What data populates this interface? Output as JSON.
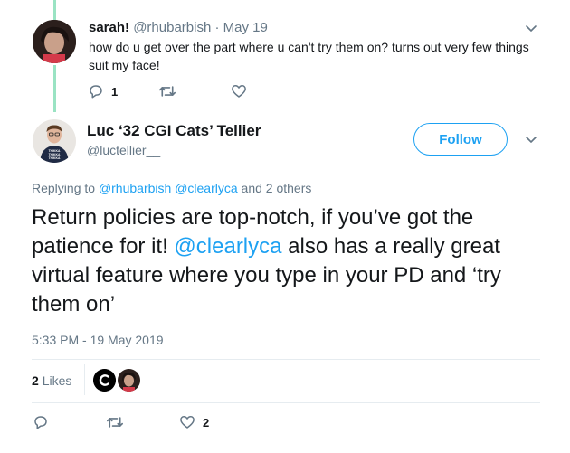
{
  "reply_tweet": {
    "display_name": "sarah!",
    "handle": "@rhubarbish",
    "separator": "·",
    "date": "May 19",
    "text": "how do u get over the part where u can't try them on? turns out very few things suit my face!",
    "reply_count": "1",
    "retweet_count": "",
    "like_count": ""
  },
  "main_tweet": {
    "display_name": "Luc ‘32 CGI Cats’ Tellier",
    "handle": "@luctellier__",
    "follow_label": "Follow",
    "replying_prefix": "Replying to",
    "replying_users": [
      "@rhubarbish",
      "@clearlyca"
    ],
    "replying_suffix": "and 2 others",
    "text_part1": "Return policies are top-notch, if you’ve got the patience for it!",
    "text_mention": "@clearlyca",
    "text_part2": "also has a really great virtual feature where you type in your PD and ‘try them on’",
    "timestamp": "5:33 PM - 19 May 2019",
    "likes_count": "2",
    "likes_label": "Likes",
    "like_count_action": "2",
    "avatar_shirt_text": [
      "THIKKA",
      "THIKKA",
      "THIKKA"
    ]
  },
  "colors": {
    "accent": "#1da1f2",
    "thread_line": "#9ae3c3",
    "muted": "#657786",
    "text": "#14171a"
  }
}
